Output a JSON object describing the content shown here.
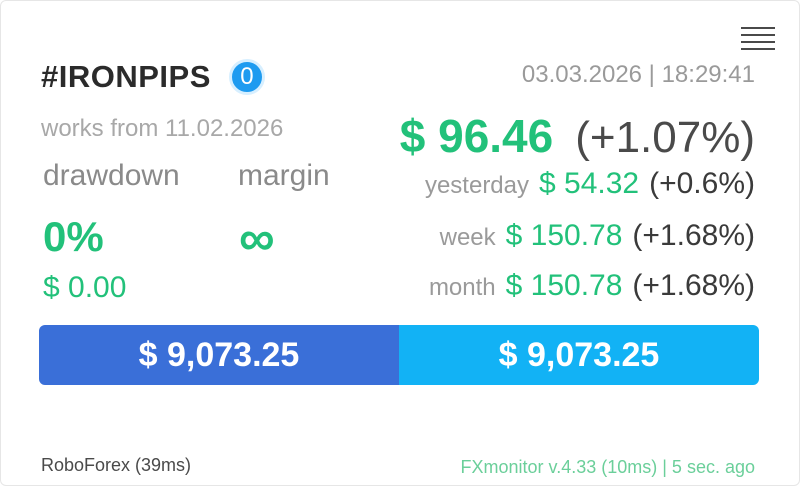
{
  "header": {
    "account_name": "#IRONPIPS",
    "badge_count": "0",
    "datetime": "03.03.2026 | 18:29:41",
    "menu_icon": "hamburger-menu-icon"
  },
  "left": {
    "works_from": "works from 11.02.2026",
    "drawdown_label": "drawdown",
    "margin_label": "margin",
    "drawdown_value": "0%",
    "margin_value": "∞",
    "drawdown_amount": "$ 0.00"
  },
  "profit": {
    "amount": "$ 96.46",
    "percent": "(+1.07%)"
  },
  "stats": [
    {
      "label": "yesterday",
      "amount": "$ 54.32",
      "percent": "(+0.6%)"
    },
    {
      "label": "week",
      "amount": "$ 150.78",
      "percent": "(+1.68%)"
    },
    {
      "label": "month",
      "amount": "$ 150.78",
      "percent": "(+1.68%)"
    }
  ],
  "balance": {
    "left": "$ 9,073.25",
    "right": "$ 9,073.25"
  },
  "footer": {
    "broker": "RoboForex (39ms)",
    "app_info": "FXmonitor v.4.33 (10ms) | 5 sec. ago"
  },
  "colors": {
    "green": "#22c17a",
    "bar_left": "#3a6fd8",
    "bar_right": "#12b2f5",
    "badge": "#1e9bf0"
  }
}
